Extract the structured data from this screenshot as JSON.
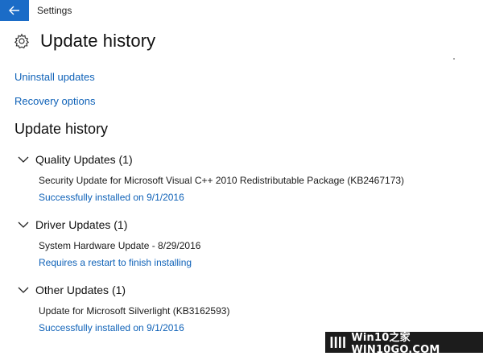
{
  "window": {
    "title": "Settings"
  },
  "header": {
    "title": "Update history",
    "icon": "gear-icon"
  },
  "links": {
    "uninstall": "Uninstall updates",
    "recovery": "Recovery options"
  },
  "section": {
    "title": "Update history"
  },
  "groups": [
    {
      "title": "Quality Updates (1)",
      "items": [
        {
          "name": "Security Update for Microsoft Visual C++ 2010 Redistributable Package (KB2467173)",
          "status": "Successfully installed on 9/1/2016"
        }
      ]
    },
    {
      "title": "Driver Updates (1)",
      "items": [
        {
          "name": "System Hardware Update - 8/29/2016",
          "status": "Requires a restart to finish installing"
        }
      ]
    },
    {
      "title": "Other Updates (1)",
      "items": [
        {
          "name": "Update for Microsoft Silverlight (KB3162593)",
          "status": "Successfully installed on 9/1/2016"
        }
      ]
    }
  ],
  "watermark": {
    "text": "Win10之家 WIN10GO.COM"
  },
  "colors": {
    "accent": "#1b6cc7",
    "link": "#0f62b8"
  }
}
